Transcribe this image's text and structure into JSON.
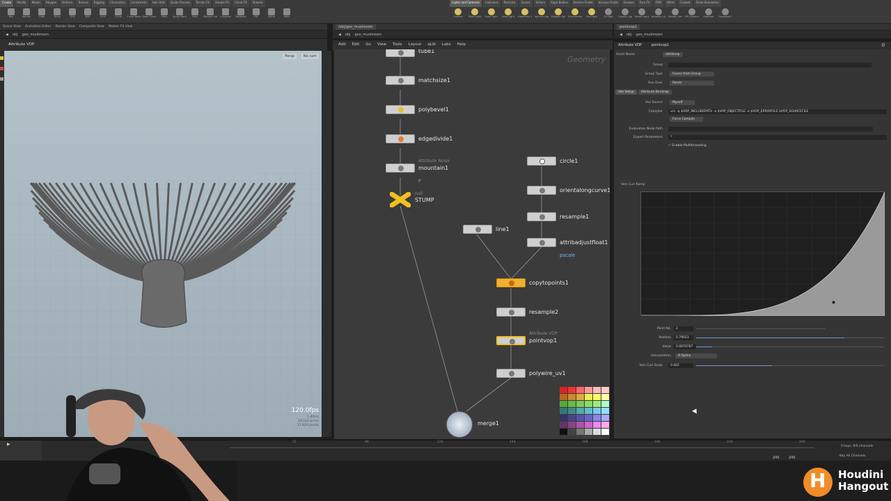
{
  "shelf": {
    "tabs": [
      "Create",
      "Modify",
      "Model",
      "Polygon",
      "Deform",
      "Texture",
      "Rigging",
      "Characters",
      "Constraints",
      "Hair Utils",
      "Guide Process",
      "Terrain FX",
      "Simple FX",
      "Cloud FX",
      "Volume"
    ],
    "tools": [
      "Box",
      "Sphere",
      "Tube",
      "Torus",
      "Grid",
      "Null",
      "Line",
      "Circle",
      "Curve Bezier",
      "Draw Curve",
      "Path",
      "Spray Paint",
      "Font",
      "Platonic Solids",
      "L-System",
      "Metaball",
      "File",
      "Spiral",
      "Helix"
    ],
    "right_tabs": [
      "Lights and Cameras",
      "Collisions",
      "Particles",
      "Grains",
      "Vellum",
      "Rigid Bodies",
      "Particle Fluids",
      "Viscous Fluids",
      "Oceans",
      "Pyro FX",
      "FEM",
      "Wires",
      "Crowds",
      "Drive Simulation"
    ],
    "right_tools": [
      "Camera",
      "Point Light",
      "Spot Light",
      "Area Light",
      "Geometry Light",
      "Volume Light",
      "Distant Light",
      "Environment Light",
      "Sky Light",
      "GI Light",
      "Caustic Light",
      "Portal Light",
      "Ambient Light",
      "Stereo Camera",
      "VR Camera",
      "Switcher",
      "Gamepad Camera"
    ]
  },
  "left_pane": {
    "tabs": [
      "Scene View",
      "Animation Editor",
      "Render View",
      "Composite View",
      "Motion FX View"
    ],
    "path": [
      "obj",
      "geo_mushroom"
    ],
    "viewport_title": "Attribute VOP",
    "persp": "Persp",
    "cam": "No cam",
    "fps": "120.0fps",
    "stats": [
      "1.40ms",
      "16,516 prims",
      "17,820 points"
    ]
  },
  "network": {
    "tab": "/obj/geo_mushroom",
    "path": [
      "obj",
      "geo_mushroom"
    ],
    "menu": [
      "Add",
      "Edit",
      "Go",
      "View",
      "Tools",
      "Layout",
      "qLib",
      "Labs",
      "Help"
    ],
    "context": "Geometry",
    "nodes": {
      "tube1": "tube1",
      "matchsize1": "matchsize1",
      "polybevel1": "polybevel1",
      "edgedivide1": "edgedivide1",
      "mountain1": "mountain1",
      "mountain1_sub": "Attribute Noise",
      "mountain1_p": "P",
      "stump": "STUMP",
      "stump_sub": "null",
      "circle1": "circle1",
      "orientalongcurve1": "orientalongcurve1",
      "resample1": "resample1",
      "line1": "line1",
      "attribadjustfloat1": "attribadjustfloat1",
      "pscale": "pscale",
      "copytopoints1": "copytopoints1",
      "resample2": "resample2",
      "pointvop1": "pointvop1",
      "pointvop1_sub": "Attribute VOP",
      "polywire_uv1": "polywire_uv1",
      "merge1": "merge1"
    }
  },
  "params": {
    "tab": "pointvop1",
    "path": [
      "obj",
      "geo_mushroom"
    ],
    "header_type": "Attribute VOP",
    "header_name": "pointvop1",
    "asset_name_label": "Asset Name",
    "asset_name": "attribvop",
    "group_label": "Group",
    "group_type_label": "Group Type",
    "group_type": "Guess from Group",
    "run_over_label": "Run Over",
    "run_over": "Points",
    "subtabs": [
      "Vex Setup",
      "Attribute Bindings"
    ],
    "vex_source_label": "Vex Source",
    "vex_source": "Myself",
    "compiler_label": "Compiler",
    "compiler": "vcc -q $VOP_INCLUDEPATH -o $VOP_OBJECTFILE -e $VOP_ERRORFILE $VOP_SOURCEFILE",
    "force_compile": "Force Compile",
    "eval_node_path_label": "Evaluation Node Path",
    "export_params_label": "Export Parameters",
    "export_params": "*",
    "enable_mt": "Enable Multithreading",
    "ramp_label": "Vein Curl Ramp",
    "point_no_label": "Point No.",
    "point_no": "2",
    "position_label": "Position",
    "position": "0.79023",
    "value_label": "Value",
    "value": "0.0870787",
    "interp_label": "Interpolation",
    "interp": "B-Spline",
    "curl_scale_label": "Vein Curl Scale",
    "curl_scale": "0.402",
    "position_fraction": 0.79023,
    "value_fraction": 0.087,
    "curl_fraction": 0.402
  },
  "timeline": {
    "ticks": [
      "72",
      "96",
      "120",
      "144",
      "168",
      "192",
      "216",
      "240"
    ],
    "start": "240",
    "end": "240",
    "keys": "0 keys, 0/0 channels",
    "key_all": "Key All Channels"
  },
  "brand": {
    "line1": "Houdini",
    "line2": "Hangout",
    "color": "#f28c28"
  }
}
